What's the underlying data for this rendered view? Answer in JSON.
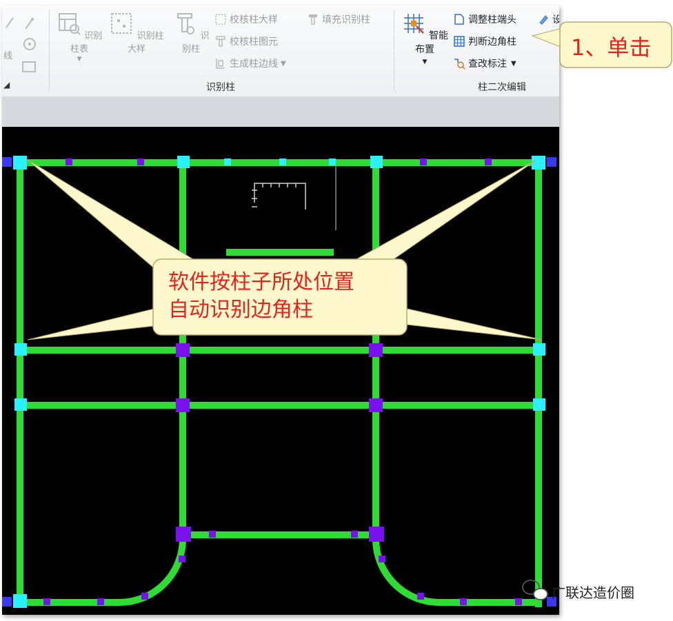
{
  "ribbon": {
    "left_partial_label": "线",
    "recognize_group": {
      "label": "识别柱",
      "buttons": {
        "recognize_table": "识别柱表",
        "recognize_detail": "识别柱大样",
        "recognize_column": "识别柱"
      },
      "small_buttons": {
        "check_detail": "校核柱大样",
        "check_element": "校核柱图元",
        "generate_edge": "生成柱边线",
        "fill_recognize": "填充识别柱"
      }
    },
    "edit_group": {
      "label": "柱二次编辑",
      "smart_layout": "智能布置",
      "adjust_end": "调整柱端头",
      "judge_corner": "判断边角柱",
      "modify_annotation": "查改标注",
      "partial_next": "设"
    }
  },
  "callouts": {
    "step": "1、单击",
    "note_line1": "软件按柱子所处位置",
    "note_line2": "自动识别边角柱"
  },
  "watermark": {
    "text": "广联达造价圈"
  },
  "colors": {
    "beam": "#2fdc33",
    "column_cyan": "#2af0ff",
    "column_purple": "#7a10f0",
    "callout_fill": "#fff8cc",
    "callout_text": "#e8211b"
  }
}
